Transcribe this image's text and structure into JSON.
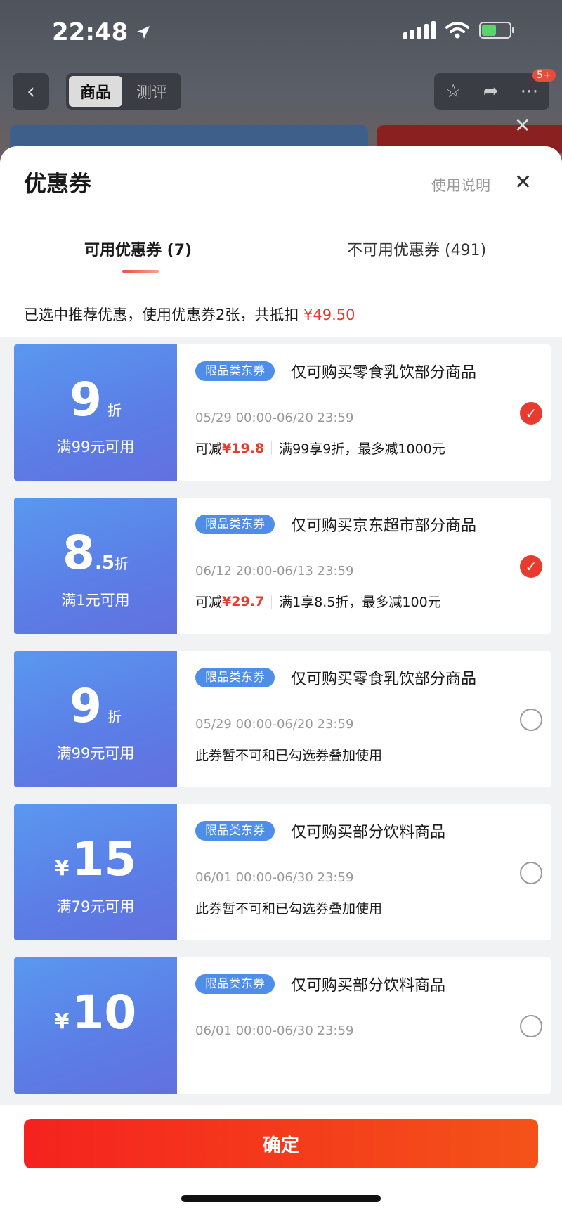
{
  "status": {
    "time": "22:48"
  },
  "topbar": {
    "tabs": [
      "商品",
      "测评"
    ],
    "badge": "5+"
  },
  "sheet": {
    "title": "优惠券",
    "usage_link": "使用说明",
    "tabs": {
      "available": "可用优惠券 (7)",
      "unavailable": "不可用优惠券 (491)"
    },
    "summary_text": "已选中推荐优惠，使用优惠券2张，共抵扣",
    "summary_amount": "¥49.50"
  },
  "coupons": [
    {
      "value_main": "9",
      "value_suffix": "折",
      "condition": "满99元可用",
      "tag": "限品类东券",
      "desc": "仅可购买零食乳饮部分商品",
      "time": "05/29 00:00-06/20 23:59",
      "deduct_label": "可减",
      "deduct_amount": "¥19.8",
      "rule": "满99享9折，最多减1000元",
      "checked": true
    },
    {
      "value_main": "8",
      "value_decimal": ".5",
      "value_suffix": "折",
      "condition": "满1元可用",
      "tag": "限品类东券",
      "desc": "仅可购买京东超市部分商品",
      "time": "06/12 20:00-06/13 23:59",
      "deduct_label": "可减",
      "deduct_amount": "¥29.7",
      "rule": "满1享8.5折，最多减100元",
      "checked": true
    },
    {
      "value_main": "9",
      "value_suffix": "折",
      "condition": "满99元可用",
      "tag": "限品类东券",
      "desc": "仅可购买零食乳饮部分商品",
      "time": "05/29 00:00-06/20 23:59",
      "note": "此券暂不可和已勾选券叠加使用",
      "checked": false
    },
    {
      "value_prefix": "¥",
      "value_main": "15",
      "condition": "满79元可用",
      "tag": "限品类东券",
      "desc": "仅可购买部分饮料商品",
      "time": "06/01 00:00-06/30 23:59",
      "note": "此券暂不可和已勾选券叠加使用",
      "checked": false
    },
    {
      "value_prefix": "¥",
      "value_main": "10",
      "condition": "",
      "tag": "限品类东券",
      "desc": "仅可购买部分饮料商品",
      "time": "06/01 00:00-06/30 23:59",
      "checked": false
    }
  ],
  "footer": {
    "confirm_label": "确定"
  },
  "colors": {
    "accent": "#e63b2e",
    "coupon_blue": "#5b7fe6",
    "tag_blue": "#4e8ee9"
  }
}
